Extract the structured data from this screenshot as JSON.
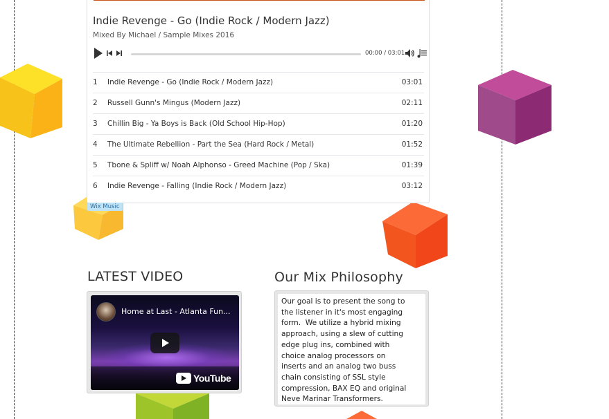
{
  "player": {
    "title": "Indie Revenge - Go (Indie Rock / Modern Jazz)",
    "subtitle": "Mixed By Michael / Sample Mixes 2016",
    "time_readout": "00:00 / 03:01",
    "accent_color": "#c7531a",
    "tracks": [
      {
        "num": "1",
        "name": "Indie Revenge - Go (Indie Rock / Modern Jazz)",
        "duration": "03:01"
      },
      {
        "num": "2",
        "name": "Russell Gunn's Mingus (Modern Jazz)",
        "duration": "02:11"
      },
      {
        "num": "3",
        "name": "Chillin Big - Ya Boys is Back (Old School Hip-Hop)",
        "duration": "01:20"
      },
      {
        "num": "4",
        "name": "The Ultimate Rebellion - Part the Sea (Hard Rock / Metal)",
        "duration": "01:52"
      },
      {
        "num": "5",
        "name": "Tbone & Spliff w/ Noah Alphonso - Greed Machine (Pop / Ska)",
        "duration": "01:39"
      },
      {
        "num": "6",
        "name": "Indie Revenge - Falling (Indie Rock / Modern Jazz)",
        "duration": "03:12"
      }
    ]
  },
  "wix_badge": "Wix Music",
  "latest_video": {
    "heading": "LATEST VIDEO",
    "video_title": "Home at Last - Atlanta Fun...",
    "brand": "YouTube"
  },
  "philosophy": {
    "heading": "Our Mix Philosophy",
    "lines": [
      "Our goal is to present the song to",
      "the listener in it's most engaging",
      "form.  We utilize a hybrid mixing",
      "approach, using a slew of cutting",
      "edge plug ins, combined with",
      "choice analog processors on",
      "inserts and an analog two buss",
      "chain consisting of SSL style",
      "compression, BAX EQ and original",
      "Neve Marinar Transformers."
    ]
  },
  "decor_colors": {
    "yellow_cube": "#f7c21a",
    "purple_cube": "#9b3a86",
    "light_yellow_cube": "#fcc93e",
    "orange_cube": "#f3551f",
    "green_cube": "#9dc428"
  }
}
